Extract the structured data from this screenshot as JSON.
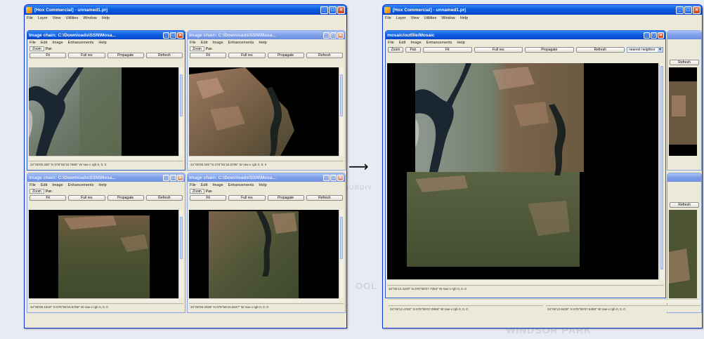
{
  "background_labels": [
    "WINDSOR PARK",
    "OOL",
    "SUBDIV"
  ],
  "left_app": {
    "title": "[Hox Commercial] - unnamed1.prj",
    "menu": [
      "File",
      "Layer",
      "View",
      "Utilities",
      "Window",
      "Help"
    ],
    "children": [
      {
        "title": "Image chain: C:\\Downloads\\SSN\\Mosa...",
        "menu": [
          "File",
          "Edit",
          "Image",
          "Enhancements",
          "Help"
        ],
        "tools": [
          "Zoom",
          "Pan"
        ],
        "buttons": [
          "Fit",
          "Full res",
          "Propagate",
          "Refresh"
        ],
        "status": "34°05'09.336\" N 078°55'16.7965\" W  raw-x rgb 0, 0, 0"
      },
      {
        "title": "Image chain: C:\\Downloads\\SSN\\Mosa...",
        "menu": [
          "File",
          "Edit",
          "Image",
          "Enhancements",
          "Help"
        ],
        "tools": [
          "Zoom",
          "Pan"
        ],
        "buttons": [
          "Fit",
          "Full res",
          "Propagate",
          "Refresh"
        ],
        "status": "34°05'09.349\" N 078°55'16.6795\" W  raw-x rgb 0, 0, 0"
      },
      {
        "title": "Image chain: C:\\Downloads\\SSN\\Mosa...",
        "menu": [
          "File",
          "Edit",
          "Image",
          "Enhancements",
          "Help"
        ],
        "tools": [
          "Zoom",
          "Pan"
        ],
        "buttons": [
          "Fit",
          "Full res",
          "Propagate",
          "Refresh"
        ],
        "status": "34°05'09.1618\" N 078°55'16.5795\" W  raw-x rgb 0, 0, 0"
      },
      {
        "title": "Image chain: C:\\Downloads\\SSN\\Mosa...",
        "menu": [
          "File",
          "Edit",
          "Image",
          "Enhancements",
          "Help"
        ],
        "tools": [
          "Zoom",
          "Pan"
        ],
        "buttons": [
          "Fit",
          "Full res",
          "Propagate",
          "Refresh"
        ],
        "status": "34°05'09.2028\" N 078°55'16.5047\" W  raw-x rgb 0, 0, 0"
      }
    ]
  },
  "right_app": {
    "title": "[Hox Commercial] - unnamed1.prj",
    "menu": [
      "File",
      "Layer",
      "View",
      "Utilities",
      "Window",
      "Help"
    ],
    "mosaic": {
      "title": "mosaic/outfile/Mosaic",
      "menu": [
        "File",
        "Edit",
        "Image",
        "Enhancements",
        "Help"
      ],
      "tools": [
        "Zoom",
        "Pan"
      ],
      "buttons": [
        "Fit",
        "Full res",
        "Propagate",
        "Refresh"
      ],
      "resample": "nearest neighbor",
      "status": "34°05'12.4220\" N 078°55'07.7253\" W  raw-x rgb 0, 0, 0"
    },
    "behind_status_left": "34°05'12.4762\" N 078°55'07.0966\" W  raw-x rgb 0, 0, 0",
    "behind_status_right": "34°05'12.6435\" N 078°55'07.6450\" W  raw-x rgb 0, 0, 0",
    "behind_label": "Refresh"
  },
  "arrow": "⟶"
}
